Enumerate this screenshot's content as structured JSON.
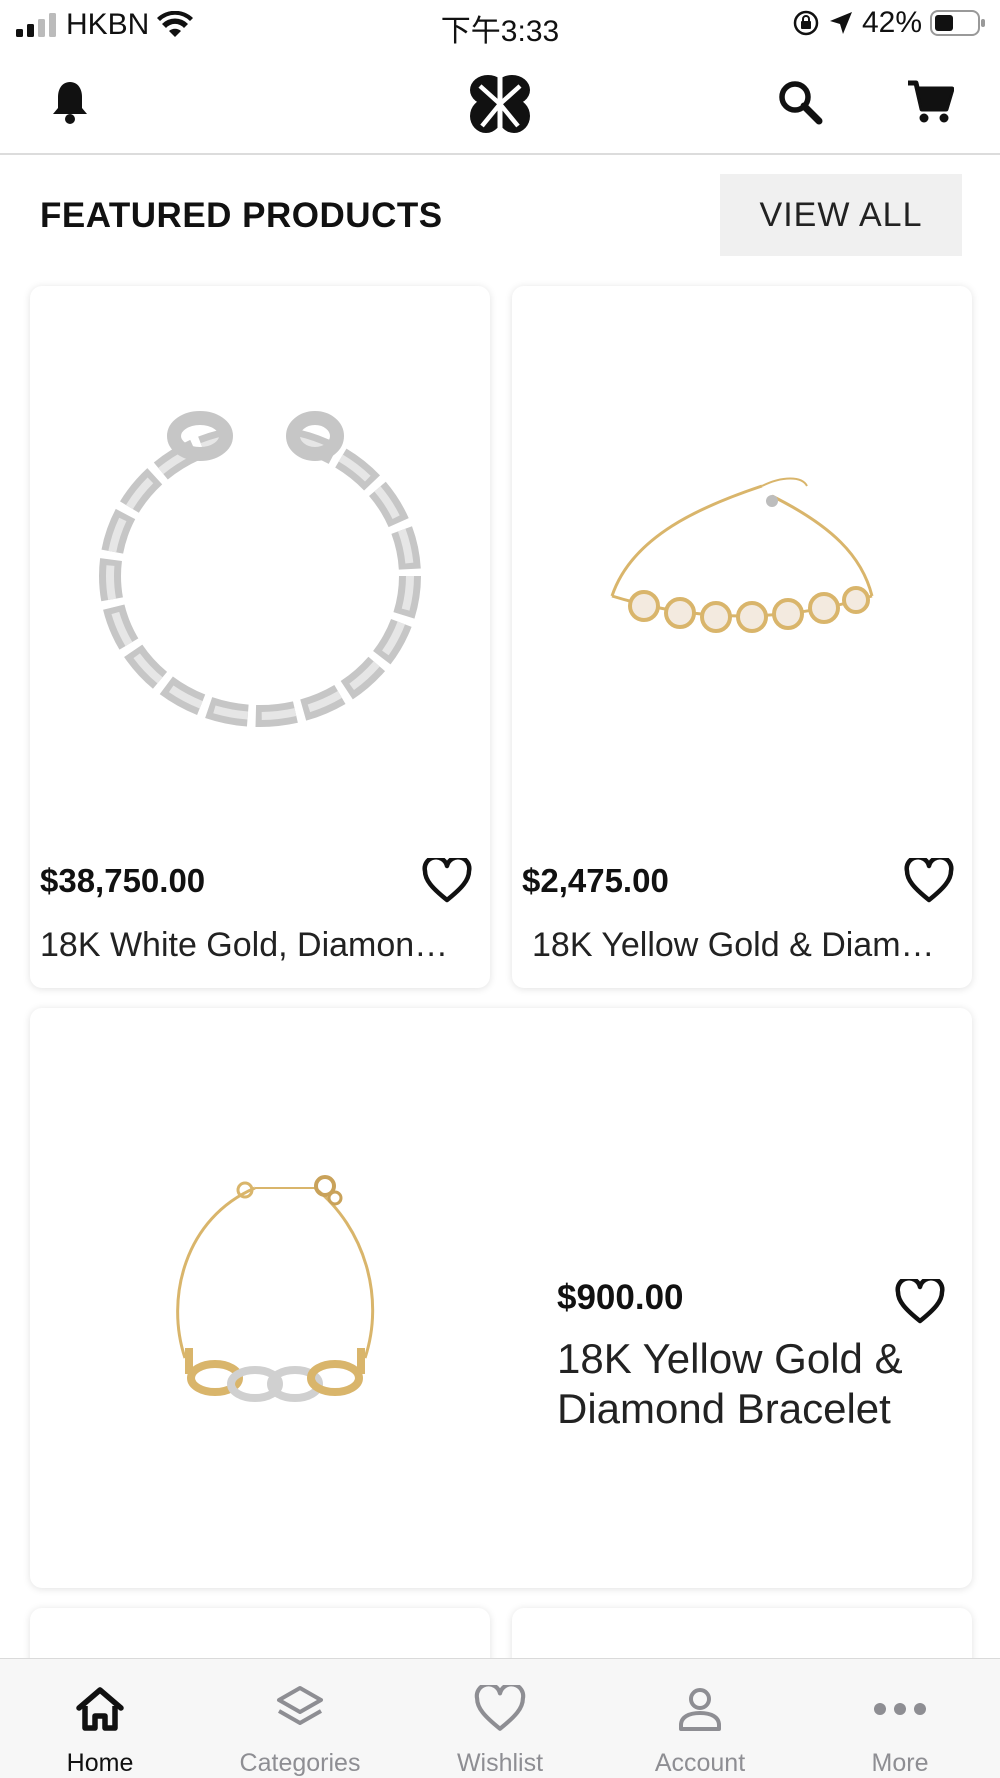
{
  "status_bar": {
    "carrier": "HKBN",
    "time": "下午3:33",
    "battery": "42%"
  },
  "nav": {
    "icons": [
      "bell-icon",
      "brand-logo",
      "search-icon",
      "cart-icon"
    ]
  },
  "section": {
    "title": "FEATURED PRODUCTS",
    "view_all_label": "VIEW ALL"
  },
  "products": [
    {
      "price": "$38,750.00",
      "name": "18K White Gold, Diamon…"
    },
    {
      "price": "$2,475.00",
      "name": "18K Yellow Gold & Diam…"
    },
    {
      "price": "$900.00",
      "name": "18K Yellow Gold & Diamond Bracelet"
    }
  ],
  "tab_bar": {
    "active": "Home",
    "tabs": [
      {
        "label": "Home",
        "icon": "home-icon"
      },
      {
        "label": "Categories",
        "icon": "layers-icon"
      },
      {
        "label": "Wishlist",
        "icon": "heart-icon"
      },
      {
        "label": "Account",
        "icon": "person-icon"
      },
      {
        "label": "More",
        "icon": "more-icon"
      }
    ]
  },
  "colors": {
    "text": "#111111",
    "inactive_tab": "#8e8e93",
    "view_all_bg": "#f0f0f0",
    "tab_bar_bg": "#f7f7f7",
    "gold": "#d9b56b",
    "silver": "#c8c8c8"
  }
}
